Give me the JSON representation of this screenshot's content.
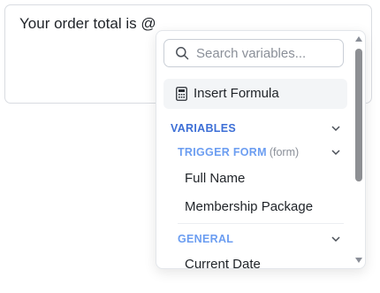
{
  "editor": {
    "text": "Your order total is @"
  },
  "dropdown": {
    "search": {
      "placeholder": "Search variables...",
      "value": ""
    },
    "formula_label": "Insert Formula",
    "sections": {
      "variables": "VARIABLES",
      "trigger_form": "TRIGGER FORM",
      "trigger_form_tag": "(form)",
      "general": "GENERAL"
    },
    "items": {
      "full_name": "Full Name",
      "membership_package": "Membership Package",
      "current_date": "Current Date"
    }
  },
  "colors": {
    "section_primary": "#3d6fd6",
    "section_secondary": "#6b9df1",
    "formula_bg": "#f3f5f7",
    "border": "#d9dce1"
  },
  "icons": [
    "search-icon",
    "calculator-icon",
    "chevron-down-icon",
    "scroll-up-arrow",
    "scroll-down-arrow"
  ]
}
